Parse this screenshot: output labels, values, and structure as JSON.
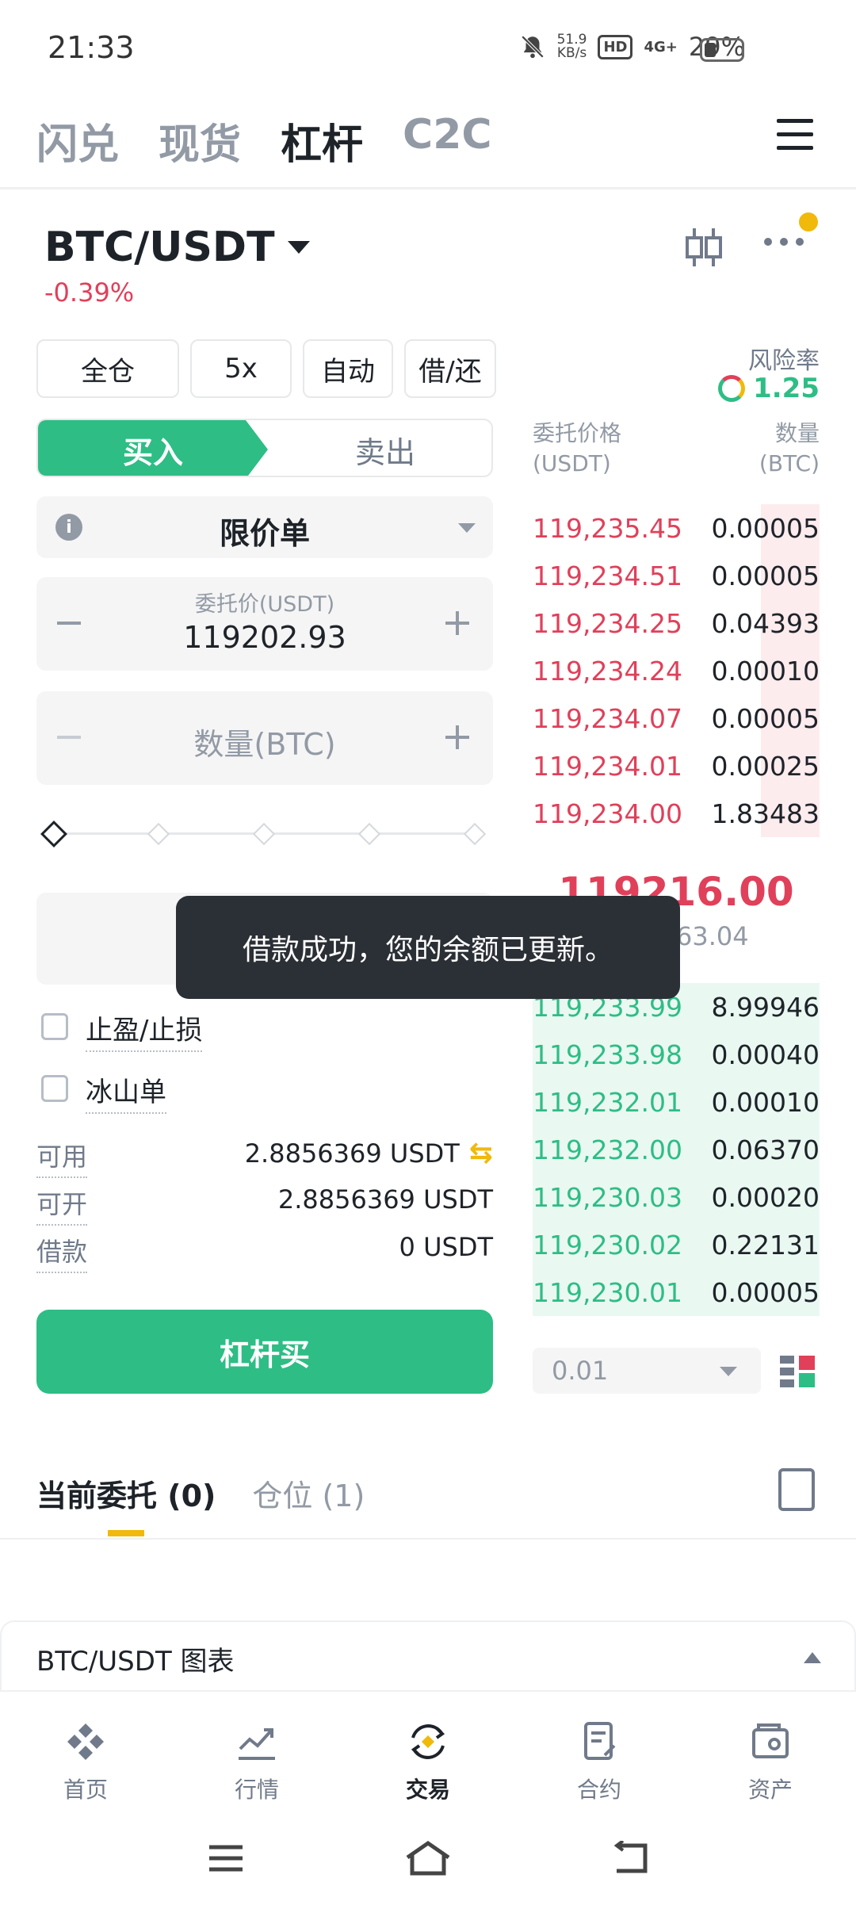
{
  "status": {
    "time": "21:33",
    "net_speed_value": "51.9",
    "net_speed_unit": "KB/s",
    "hd": "HD",
    "signal": "4G+",
    "battery": "29%"
  },
  "top_tabs": [
    {
      "label": "闪兑"
    },
    {
      "label": "现货"
    },
    {
      "label": "杠杆"
    },
    {
      "label": "C2C"
    }
  ],
  "header": {
    "pair": "BTC/USDT",
    "change": "-0.39%"
  },
  "settings": {
    "margin_mode": "全仓",
    "leverage": "5x",
    "auto": "自动",
    "borrow_repay": "借/还"
  },
  "risk": {
    "label": "风险率",
    "value": "1.25"
  },
  "side_tabs": {
    "buy": "买入",
    "sell": "卖出"
  },
  "order_type": "限价单",
  "price_field": {
    "label": "委托价(USDT)",
    "value": "119202.93"
  },
  "amount_field": {
    "placeholder": "数量(BTC)"
  },
  "options": {
    "tp_sl": "止盈/止损",
    "iceberg": "冰山单"
  },
  "balances": [
    {
      "label": "可用",
      "value": "2.8856369 USDT"
    },
    {
      "label": "可开",
      "value": "2.8856369 USDT"
    },
    {
      "label": "借款",
      "value": "0 USDT"
    }
  ],
  "action_button": "杠杆买",
  "orderbook": {
    "price_header_1": "委托价格",
    "price_header_2": "(USDT)",
    "qty_header_1": "数量",
    "qty_header_2": "(BTC)",
    "asks": [
      {
        "price": "119,235.45",
        "qty": "0.00005"
      },
      {
        "price": "119,234.51",
        "qty": "0.00005"
      },
      {
        "price": "119,234.25",
        "qty": "0.04393"
      },
      {
        "price": "119,234.24",
        "qty": "0.00010"
      },
      {
        "price": "119,234.07",
        "qty": "0.00005"
      },
      {
        "price": "119,234.01",
        "qty": "0.00025"
      },
      {
        "price": "119,234.00",
        "qty": "1.83483"
      }
    ],
    "mid_price": "119216.00",
    "mid_sub": "257,163.04",
    "bids": [
      {
        "price": "119,233.99",
        "qty": "8.99946"
      },
      {
        "price": "119,233.98",
        "qty": "0.00040"
      },
      {
        "price": "119,232.01",
        "qty": "0.00010"
      },
      {
        "price": "119,232.00",
        "qty": "0.06370"
      },
      {
        "price": "119,230.03",
        "qty": "0.00020"
      },
      {
        "price": "119,230.02",
        "qty": "0.22131"
      },
      {
        "price": "119,230.01",
        "qty": "0.00005"
      }
    ],
    "precision": "0.01"
  },
  "orders_tabs": {
    "current": "当前委托 (0)",
    "positions": "仓位 (1)"
  },
  "chart_bar": {
    "label": "BTC/USDT 图表"
  },
  "bottom_nav": [
    {
      "label": "首页"
    },
    {
      "label": "行情"
    },
    {
      "label": "交易"
    },
    {
      "label": "合约"
    },
    {
      "label": "资产"
    }
  ],
  "toast": "借款成功，您的余额已更新。",
  "colors": {
    "buy_green": "#2ebd85",
    "sell_red": "#e0405a",
    "accent_yellow": "#f0b90b"
  }
}
